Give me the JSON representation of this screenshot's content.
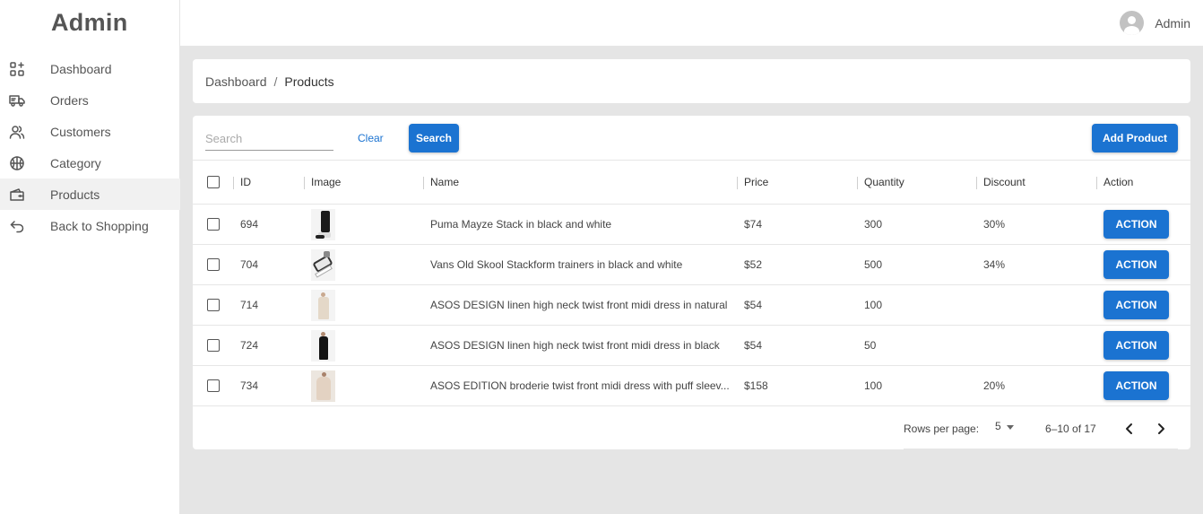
{
  "sidebar": {
    "brand": "Admin",
    "items": [
      {
        "label": "Dashboard",
        "icon": "dashboard-icon"
      },
      {
        "label": "Orders",
        "icon": "truck-icon"
      },
      {
        "label": "Customers",
        "icon": "users-icon"
      },
      {
        "label": "Category",
        "icon": "basketball-icon"
      },
      {
        "label": "Products",
        "icon": "wallet-icon",
        "active": true
      },
      {
        "label": "Back to Shopping",
        "icon": "arrow-back-icon"
      }
    ]
  },
  "topbar": {
    "user_name": "Admin",
    "avatar_icon": "user-avatar-icon"
  },
  "breadcrumb": {
    "root": "Dashboard",
    "separator": "/",
    "current": "Products"
  },
  "toolbar": {
    "search_placeholder": "Search",
    "search_value": "",
    "clear_label": "Clear",
    "search_label": "Search",
    "add_label": "Add Product"
  },
  "table": {
    "columns": {
      "id": "ID",
      "image": "Image",
      "name": "Name",
      "price": "Price",
      "quantity": "Quantity",
      "discount": "Discount",
      "action": "Action"
    },
    "rows": [
      {
        "id": "694",
        "name": "Puma Mayze Stack in black and white",
        "price": "$74",
        "quantity": "300",
        "discount": "30%",
        "action": "ACTION"
      },
      {
        "id": "704",
        "name": "Vans Old Skool Stackform trainers in black and white",
        "price": "$52",
        "quantity": "500",
        "discount": "34%",
        "action": "ACTION"
      },
      {
        "id": "714",
        "name": "ASOS DESIGN linen high neck twist front midi dress in natural",
        "price": "$54",
        "quantity": "100",
        "discount": "",
        "action": "ACTION"
      },
      {
        "id": "724",
        "name": "ASOS DESIGN linen high neck twist front midi dress in black",
        "price": "$54",
        "quantity": "50",
        "discount": "",
        "action": "ACTION"
      },
      {
        "id": "734",
        "name": "ASOS EDITION broderie twist front midi dress with puff sleev...",
        "price": "$158",
        "quantity": "100",
        "discount": "20%",
        "action": "ACTION"
      }
    ]
  },
  "pagination": {
    "rows_per_page_label": "Rows per page:",
    "rows_per_page": "5",
    "range": "6–10 of 17"
  },
  "colors": {
    "primary": "#1b73d1",
    "background": "#e5e5e5",
    "surface": "#ffffff"
  }
}
